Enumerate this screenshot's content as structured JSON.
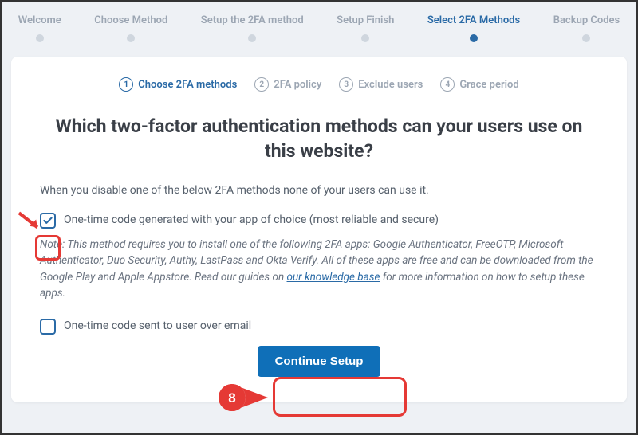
{
  "stepper": [
    {
      "label": "Welcome",
      "active": false
    },
    {
      "label": "Choose Method",
      "active": false
    },
    {
      "label": "Setup the 2FA method",
      "active": false
    },
    {
      "label": "Setup Finish",
      "active": false
    },
    {
      "label": "Select 2FA Methods",
      "active": true
    },
    {
      "label": "Backup Codes",
      "active": false
    }
  ],
  "substeps": [
    {
      "num": "1",
      "label": "Choose 2FA methods",
      "current": true
    },
    {
      "num": "2",
      "label": "2FA policy",
      "current": false
    },
    {
      "num": "3",
      "label": "Exclude users",
      "current": false
    },
    {
      "num": "4",
      "label": "Grace period",
      "current": false
    }
  ],
  "heading": "Which two-factor authentication methods can your users use on this website?",
  "intro": "When you disable one of the below 2FA methods none of your users can use it.",
  "methods": [
    {
      "label": "One-time code generated with your app of choice (most reliable and secure)",
      "checked": true
    },
    {
      "label": "One-time code sent to user over email",
      "checked": false
    }
  ],
  "note": {
    "prefix": "Note: This method requires you to install one of the following 2FA apps: Google Authenticator, FreeOTP, Microsoft Authenticator, Duo Security, Authy, LastPass and Okta Verify. All of these apps are free and can be downloaded from the Google Play and Apple Appstore. Read our guides on ",
    "link": "our knowledge base",
    "suffix": " for more information on how to setup these apps."
  },
  "button": "Continue Setup",
  "annotation": {
    "balloon": "8"
  }
}
